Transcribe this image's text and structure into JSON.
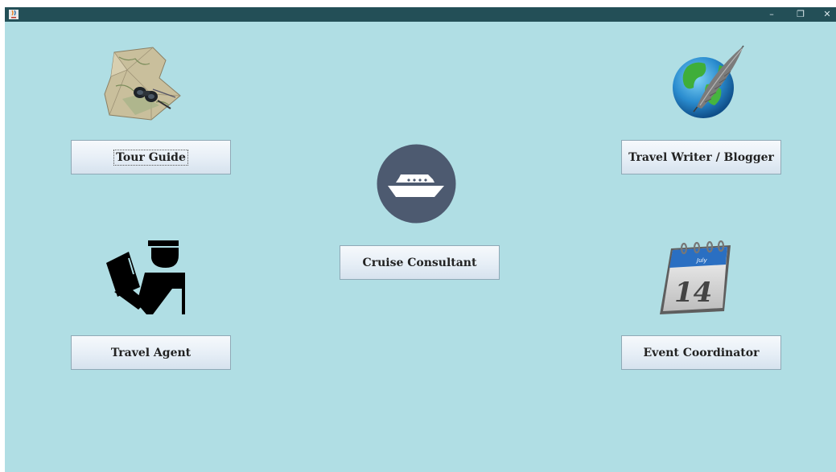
{
  "window": {
    "title": "",
    "controls": {
      "minimize": "–",
      "restore": "❐",
      "close": "✕"
    }
  },
  "colors": {
    "background": "#b0dee4",
    "titlebar": "#234f57",
    "ship_circle": "#4d5a70"
  },
  "buttons": {
    "tour_guide": "Tour Guide",
    "travel_writer": "Travel Writer / Blogger",
    "cruise_consultant": "Cruise Consultant",
    "travel_agent": "Travel Agent",
    "event_coordinator": "Event Coordinator"
  },
  "icons": {
    "tour_guide": "map-binoculars-icon",
    "travel_writer": "globe-quill-icon",
    "cruise_consultant": "cruise-ship-icon",
    "travel_agent": "officer-passport-icon",
    "event_coordinator": "calendar-icon"
  },
  "calendar": {
    "day": "14",
    "month": "July"
  }
}
